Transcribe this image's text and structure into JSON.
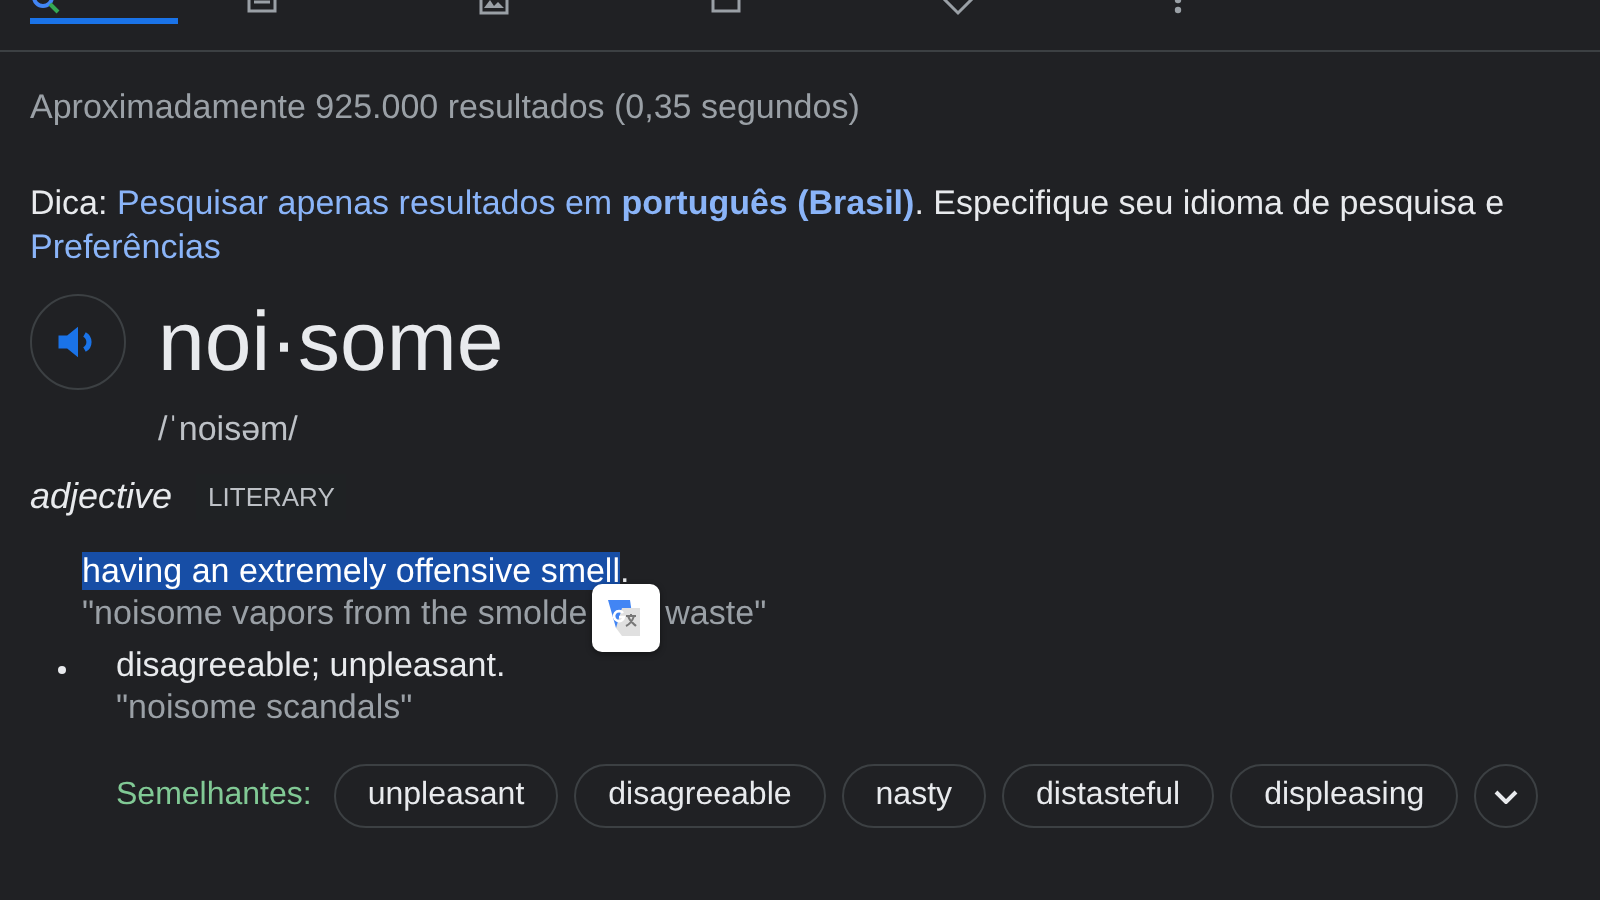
{
  "tabs": [
    {
      "kind": "search",
      "selected": true
    },
    {
      "kind": "news",
      "selected": false
    },
    {
      "kind": "image",
      "selected": false
    },
    {
      "kind": "video",
      "selected": false
    },
    {
      "kind": "tag",
      "selected": false
    },
    {
      "kind": "more",
      "selected": false
    }
  ],
  "result_stats": "Aproximadamente 925.000 resultados (0,35 segundos)",
  "tip": {
    "label": "Dica:",
    "link": "Pesquisar apenas resultados em **português (Brasil)**",
    "text": ". Especifique seu idioma de pesquisa e",
    "preferences_link": "Preferências"
  },
  "dictionary": {
    "word": "noi·some",
    "phonetic": "/ˈnoisəm/",
    "part_of_speech": "adjective",
    "register": "LITERARY",
    "definitions": [
      {
        "text": "having an extremely offensive smell",
        "suffix": ".",
        "highlighted": true,
        "bullet": false,
        "example_parts": [
          "\"noisome vapors from the smolde",
          "waste\""
        ]
      },
      {
        "text": "disagreeable; unpleasant.",
        "highlighted": false,
        "bullet": true,
        "example_parts": [
          "\"noisome scandals\""
        ]
      }
    ],
    "synonyms_label": "Semelhantes:",
    "synonyms": [
      "unpleasant",
      "disagreeable",
      "nasty",
      "distasteful",
      "displeasing"
    ]
  }
}
